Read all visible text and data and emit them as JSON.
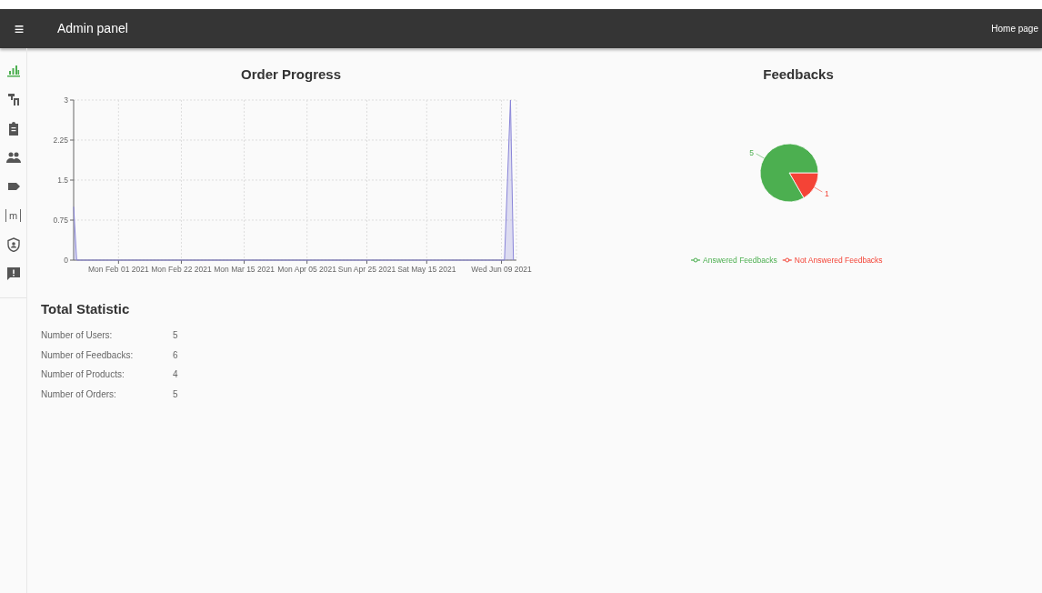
{
  "navbar": {
    "menu_glyph": "≡",
    "title": "Admin panel",
    "link": "Home page"
  },
  "sidebar": {
    "items": [
      {
        "kind": "chart",
        "selected": true
      },
      {
        "kind": "clothing",
        "selected": false
      },
      {
        "kind": "clipboard",
        "selected": false
      },
      {
        "kind": "people",
        "selected": false
      },
      {
        "kind": "label",
        "selected": false
      },
      {
        "kind": "letter",
        "glyph": "m",
        "selected": false
      },
      {
        "kind": "shield",
        "selected": false
      },
      {
        "kind": "feedback",
        "selected": false
      }
    ]
  },
  "order_progress": {
    "title": "Order Progress",
    "chart_data": {
      "type": "area",
      "x": [
        "2021-01-17",
        "2021-01-18",
        "2021-06-10",
        "2021-06-12",
        "2021-06-13"
      ],
      "series": [
        {
          "color": "#8884d8",
          "values": [
            1,
            0,
            0,
            3,
            0
          ]
        }
      ],
      "grid": true,
      "xlim": [
        "2021-01-17",
        "2021-06-14"
      ],
      "ylim": [
        0,
        3
      ],
      "yticks": [
        {
          "value": 0,
          "label": "0"
        },
        {
          "value": 0.75,
          "label": "0.75"
        },
        {
          "value": 1.5,
          "label": "1.5"
        },
        {
          "value": 2.25,
          "label": "2.25"
        },
        {
          "value": 3,
          "label": "3"
        }
      ],
      "xticks": [
        {
          "value": "2021-02-01",
          "label": "Mon Feb 01 2021"
        },
        {
          "value": "2021-02-22",
          "label": "Mon Feb 22 2021"
        },
        {
          "value": "2021-03-15",
          "label": "Mon Mar 15 2021"
        },
        {
          "value": "2021-04-05",
          "label": "Mon Apr 05 2021"
        },
        {
          "value": "2021-04-25",
          "label": "Sun Apr 25 2021"
        },
        {
          "value": "2021-05-15",
          "label": "Sat May 15 2021"
        },
        {
          "value": "2021-06-09",
          "label": "Wed Jun 09 2021"
        }
      ]
    }
  },
  "feedbacks": {
    "title": "Feedbacks",
    "chart_data": {
      "type": "pie",
      "categories": [
        "Answered Feedbacks",
        "Not Answered Feedbacks"
      ],
      "series": [
        {
          "values": [
            5,
            1
          ]
        }
      ],
      "colors": [
        "#4caf50",
        "#f44336"
      ],
      "data_labels": true,
      "legend": "bottom"
    }
  },
  "total_statistic": {
    "title": "Total Statistic",
    "rows": [
      {
        "label": "Number of Users:",
        "value": "5"
      },
      {
        "label": "Number of Feedbacks:",
        "value": "6"
      },
      {
        "label": "Number of Products:",
        "value": "4"
      },
      {
        "label": "Number of Orders:",
        "value": "5"
      }
    ]
  }
}
